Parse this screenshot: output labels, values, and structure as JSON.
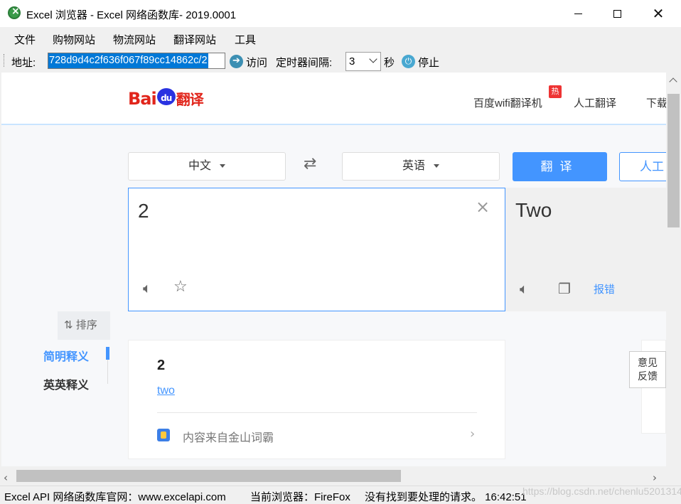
{
  "window": {
    "title": "Excel 浏览器  - Excel 网络函数库- 2019.0001"
  },
  "menu": [
    "文件",
    "购物网站",
    "物流网站",
    "翻译网站",
    "工具"
  ],
  "toolbar": {
    "address_label": "地址:",
    "address_value": "728d9d4c2f636f067f89cc14862c/2",
    "visit_label": "访问",
    "timer_label": "定时器间隔:",
    "timer_value": "3",
    "seconds_label": "秒",
    "stop_label": "停止"
  },
  "site": {
    "logo_bai": "Bai",
    "logo_du": "du",
    "logo_fanyi": "翻译",
    "nav": [
      "百度wifi翻译机",
      "人工翻译",
      "下载"
    ],
    "hot_badge": "热",
    "source_lang": "中文",
    "target_lang": "英语",
    "translate_btn": "翻译",
    "human_btn": "人工",
    "source_text": "2",
    "target_text": "Two",
    "report_link": "报错",
    "sort_label": "排序",
    "side_items": [
      "简明释义",
      "英英释义"
    ],
    "dict_word": "2",
    "dict_link": "two",
    "source_credit": "内容来自金山词霸",
    "feedback": [
      "意见",
      "反馈"
    ]
  },
  "status": {
    "site_info": "Excel API 网络函数库官网：www.excelapi.com",
    "browser_info": "当前浏览器：FireFox",
    "request_info": "没有找到要处理的请求。 16:42:51",
    "watermark": "https://blog.csdn.net/chenlu5201314"
  },
  "colors": {
    "accent": "#4395ff",
    "selection": "#0078d7",
    "logo_red": "#e1251b",
    "logo_blue": "#2932e1"
  }
}
